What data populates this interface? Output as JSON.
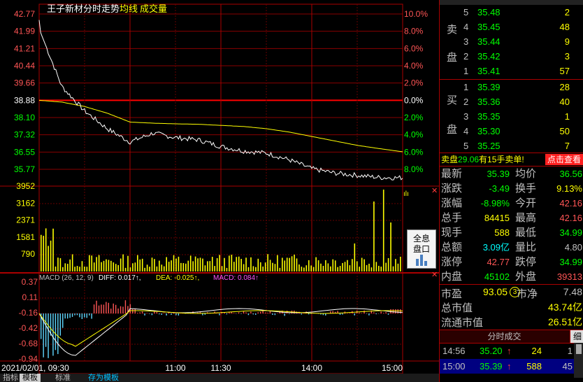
{
  "chart": {
    "title": "王子新材分时走势",
    "legend_avg": "均线",
    "legend_vol": "成交量",
    "date_time": "2021/02/01, 09:30",
    "x_ticks": [
      "11:00",
      "11:30",
      "14:00",
      "15:00"
    ],
    "price_labels": [
      "42.77",
      "41.99",
      "41.21",
      "40.44",
      "39.66",
      "38.88",
      "38.10",
      "37.32",
      "36.55",
      "35.77"
    ],
    "pct_labels": [
      "10.0%",
      "8.0%",
      "6.0%",
      "4.0%",
      "2.0%",
      "0.0%",
      "2.0%",
      "4.0%",
      "6.0%",
      "8.0%"
    ],
    "vol_labels": [
      "3952",
      "3162",
      "2371",
      "1581",
      "790"
    ],
    "macd_labels": [
      "0.37",
      "0.11",
      "-0.16",
      "-0.42",
      "-0.68",
      "-0.94"
    ],
    "macd_header": {
      "params": "MACD (26, 12, 9)",
      "diff": "DIFF: 0.017↑,",
      "dea": "DEA: -0.025↑,",
      "macd": "MACD: 0.084↑"
    },
    "button_line1": "全息",
    "button_line2": "盘口"
  },
  "chart_data": {
    "type": "line",
    "title": "王子新材分时走势",
    "prev_close": 38.88,
    "ylim": [
      34.99,
      42.77
    ],
    "time_range": [
      "09:30",
      "15:00"
    ],
    "series": [
      {
        "name": "均线",
        "color": "#ffff00",
        "values": [
          38.88,
          38.8,
          38.6,
          38.3,
          37.9,
          37.85,
          37.82,
          37.8,
          37.75,
          37.7,
          37.6,
          37.45,
          37.25,
          37.05,
          36.85,
          36.7,
          36.56
        ]
      },
      {
        "name": "price",
        "color": "#ffffff",
        "values": [
          42.1,
          39.5,
          38.4,
          37.6,
          37.0,
          37.4,
          37.2,
          37.1,
          36.8,
          36.6,
          36.5,
          36.2,
          35.8,
          35.6,
          35.5,
          35.4,
          35.39
        ]
      }
    ],
    "volume": {
      "name": "成交量",
      "ylim": [
        0,
        3952
      ]
    },
    "macd": {
      "diff": 0.017,
      "dea": -0.025,
      "macd": 0.084,
      "ylim": [
        -0.94,
        0.37
      ]
    }
  },
  "orderbook": {
    "sell_label": [
      "卖",
      "盘"
    ],
    "buy_label": [
      "买",
      "盘"
    ],
    "sell": [
      {
        "lvl": "5",
        "price": "35.48",
        "vol": "2"
      },
      {
        "lvl": "4",
        "price": "35.45",
        "vol": "48"
      },
      {
        "lvl": "3",
        "price": "35.44",
        "vol": "9"
      },
      {
        "lvl": "2",
        "price": "35.42",
        "vol": "3"
      },
      {
        "lvl": "1",
        "price": "35.41",
        "vol": "57"
      }
    ],
    "buy": [
      {
        "lvl": "1",
        "price": "35.39",
        "vol": "28"
      },
      {
        "lvl": "2",
        "price": "35.36",
        "vol": "40"
      },
      {
        "lvl": "3",
        "price": "35.35",
        "vol": "1"
      },
      {
        "lvl": "4",
        "price": "35.30",
        "vol": "50"
      },
      {
        "lvl": "5",
        "price": "35.25",
        "vol": "7"
      }
    ],
    "notice_prefix": "卖盘",
    "notice_value": "29.06",
    "notice_suffix": "有15手卖单!",
    "view_button": "点击查看"
  },
  "stats": [
    {
      "l1": "最新",
      "v1": "35.39",
      "c1": "#00ff00",
      "l2": "均价",
      "v2": "36.56",
      "c2": "#00ff00"
    },
    {
      "l1": "涨跌",
      "v1": "-3.49",
      "c1": "#00ff00",
      "l2": "换手",
      "v2": "9.13%",
      "c2": "#ffff00"
    },
    {
      "l1": "涨幅",
      "v1": "-8.98%",
      "c1": "#00ff00",
      "l2": "今开",
      "v2": "42.16",
      "c2": "#ff5555"
    },
    {
      "l1": "总手",
      "v1": "84415",
      "c1": "#ffff00",
      "l2": "最高",
      "v2": "42.16",
      "c2": "#ff5555"
    },
    {
      "l1": "现手",
      "v1": "588",
      "c1": "#ffff00",
      "l2": "最低",
      "v2": "34.99",
      "c2": "#00ff00"
    },
    {
      "l1": "总额",
      "v1": "3.09亿",
      "c1": "#00ffff",
      "l2": "量比",
      "v2": "4.80",
      "c2": "#c0c0c0"
    },
    {
      "l1": "涨停",
      "v1": "42.77",
      "c1": "#ff5555",
      "l2": "跌停",
      "v2": "34.99",
      "c2": "#00ff00"
    },
    {
      "l1": "内盘",
      "v1": "45102",
      "c1": "#00ff00",
      "l2": "外盘",
      "v2": "39313",
      "c2": "#ff5555"
    }
  ],
  "valuation": {
    "pe_label": "市盈",
    "pe_value": "93.05",
    "pe_badge": "3",
    "pb_label": "市净",
    "pb_value": "7.48",
    "mcap_label": "总市值",
    "mcap_value": "43.74亿",
    "fmcap_label": "流通市值",
    "fmcap_value": "26.51亿"
  },
  "ticks": {
    "header": "分时成交",
    "detail": "细",
    "rows": [
      {
        "time": "14:56",
        "price": "35.20",
        "arrow": "↑",
        "vol": "24",
        "n": "1"
      },
      {
        "time": "15:00",
        "price": "35.39",
        "arrow": "↑",
        "vol": "588",
        "n": "45"
      }
    ]
  },
  "bottom_tabs": [
    "指标",
    "模板",
    "标准",
    "存为模板"
  ]
}
